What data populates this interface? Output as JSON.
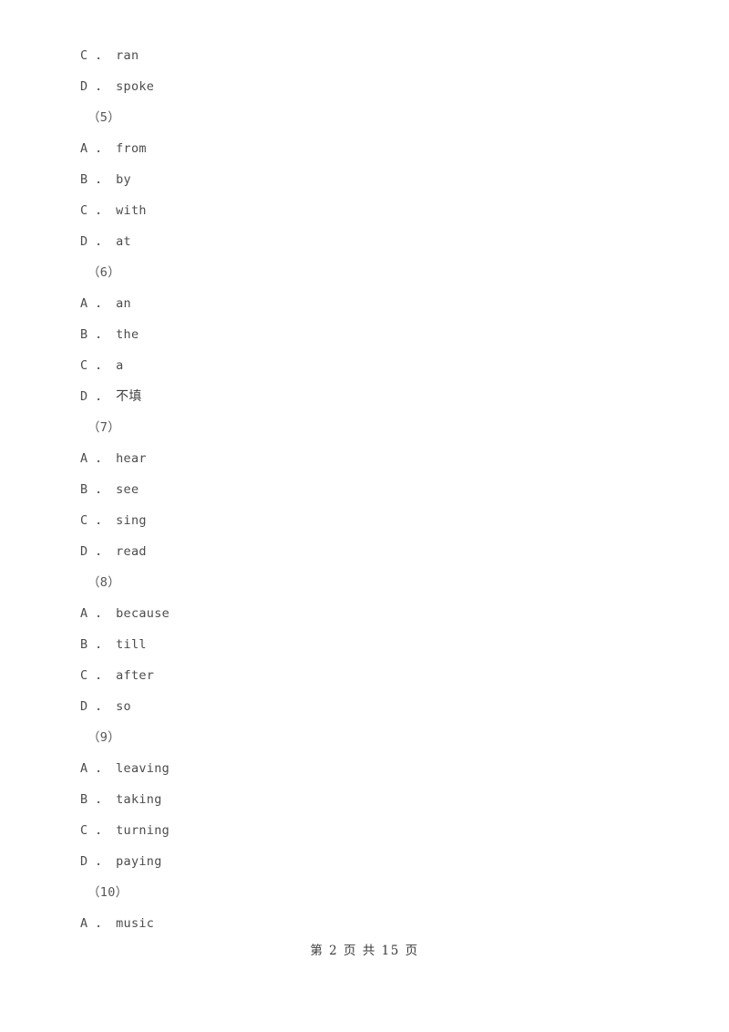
{
  "document": {
    "type": "exam-paper-scan",
    "background_color": "#ffffff",
    "text_color": "#4d4d4d"
  },
  "lines": [
    {
      "kind": "option",
      "text": "C ． ran"
    },
    {
      "kind": "option",
      "text": "D ． spoke"
    },
    {
      "kind": "qnum",
      "text": "（5）"
    },
    {
      "kind": "option",
      "text": "A ． from"
    },
    {
      "kind": "option",
      "text": "B ． by"
    },
    {
      "kind": "option",
      "text": "C ． with"
    },
    {
      "kind": "option",
      "text": "D ． at"
    },
    {
      "kind": "qnum",
      "text": "（6）"
    },
    {
      "kind": "option",
      "text": "A ． an"
    },
    {
      "kind": "option",
      "text": "B ． the"
    },
    {
      "kind": "option",
      "text": "C ． a"
    },
    {
      "kind": "option",
      "text": "D ． 不填",
      "cjk": true
    },
    {
      "kind": "qnum",
      "text": "（7）"
    },
    {
      "kind": "option",
      "text": "A ． hear"
    },
    {
      "kind": "option",
      "text": "B ． see"
    },
    {
      "kind": "option",
      "text": "C ． sing"
    },
    {
      "kind": "option",
      "text": "D ． read"
    },
    {
      "kind": "qnum",
      "text": "（8）"
    },
    {
      "kind": "option",
      "text": "A ． because"
    },
    {
      "kind": "option",
      "text": "B ． till"
    },
    {
      "kind": "option",
      "text": "C ． after"
    },
    {
      "kind": "option",
      "text": "D ． so"
    },
    {
      "kind": "qnum",
      "text": "（9）"
    },
    {
      "kind": "option",
      "text": "A ． leaving"
    },
    {
      "kind": "option",
      "text": "B ． taking"
    },
    {
      "kind": "option",
      "text": "C ． turning"
    },
    {
      "kind": "option",
      "text": "D ． paying"
    },
    {
      "kind": "qnum",
      "text": "（10）"
    },
    {
      "kind": "option",
      "text": "A ． music"
    }
  ],
  "footer": {
    "text": "第 2 页 共 15 页",
    "page_number": "2",
    "total_pages": "15"
  }
}
